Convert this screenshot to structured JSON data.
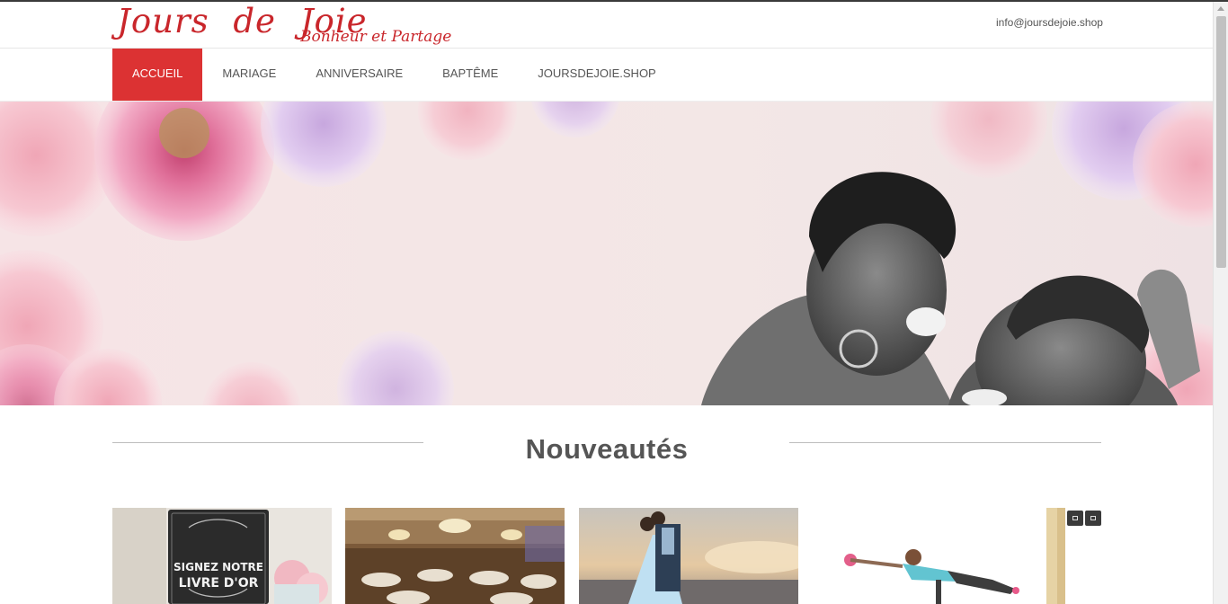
{
  "site": {
    "logo_main": "Jours de Joie",
    "logo_tagline": "Bonheur et Partage",
    "email": "info@joursdejoie.shop"
  },
  "nav": {
    "items": [
      {
        "label": "ACCUEIL",
        "active": true
      },
      {
        "label": "MARIAGE",
        "active": false
      },
      {
        "label": "ANNIVERSAIRE",
        "active": false
      },
      {
        "label": "BAPTÊME",
        "active": false
      },
      {
        "label": "JOURSDEJOIE.SHOP",
        "active": false
      }
    ]
  },
  "section": {
    "title": "Nouveautés"
  },
  "products": [
    {
      "image": "chalkboard-sign-photo",
      "sign_line1": "SIGNEZ NOTRE",
      "sign_line2": "LIVRE D'OR"
    },
    {
      "image": "banquet-hall-photo"
    },
    {
      "image": "wedding-couple-photo"
    },
    {
      "image": "fitness-woman-photo"
    },
    {
      "image": "partial-product-photo"
    }
  ],
  "colors": {
    "brand_red": "#dc3233",
    "logo_red": "#c9262b",
    "text_grey": "#555555"
  }
}
